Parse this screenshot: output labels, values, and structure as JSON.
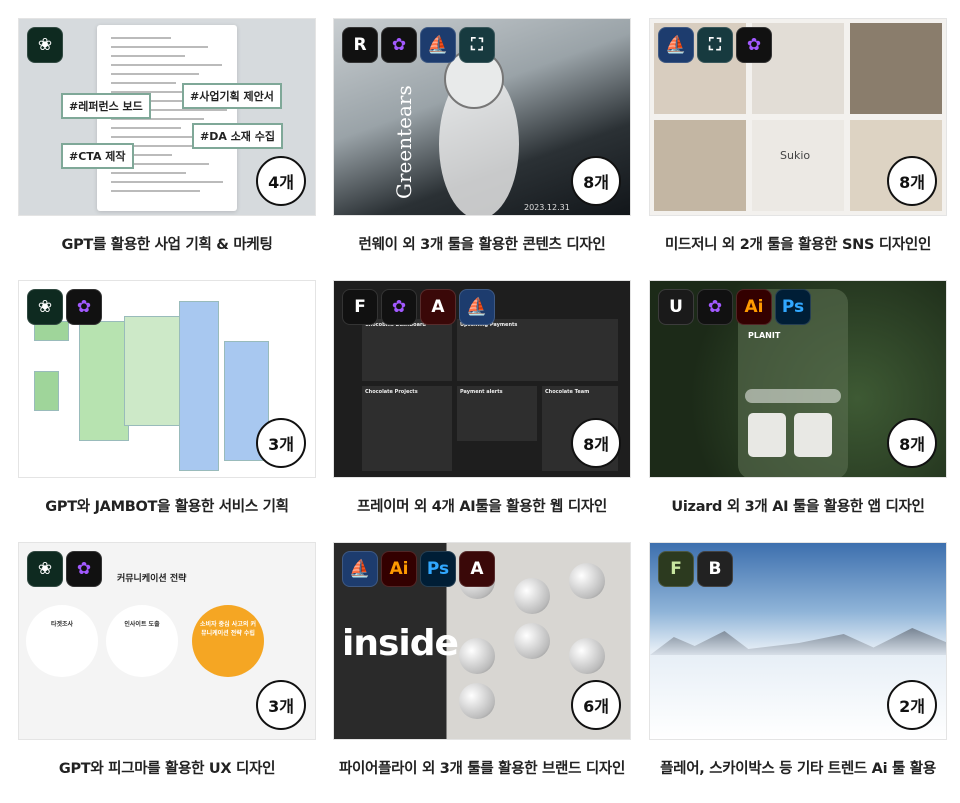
{
  "cards": [
    {
      "title": "GPT를 활용한 사업 기획 & 마케팅",
      "count": "4개",
      "icons": [
        "chatgpt-icon"
      ],
      "theme": "doc",
      "tags": [
        "#레퍼런스 보드",
        "#사업기획 제안서",
        "#DA 소재 수집",
        "#CTA 제작"
      ]
    },
    {
      "title": "런웨이 외 3개 툴을 활용한 콘텐츠 디자인",
      "count": "8개",
      "icons": [
        "runway-icon",
        "figma-icon",
        "midjourney-icon",
        "clipdrop-icon"
      ],
      "theme": "ocean",
      "text": "Greentears",
      "date": "2023.12.31"
    },
    {
      "title": "미드저니 외 2개 툴을 활용한 SNS 디자인인",
      "count": "8개",
      "icons": [
        "midjourney-icon",
        "clipdrop-icon",
        "figma-icon"
      ],
      "theme": "jewel",
      "text": "Sukio"
    },
    {
      "title": "GPT와 JAMBOT을 활용한 서비스 기획",
      "count": "3개",
      "icons": [
        "chatgpt-icon",
        "figma-icon"
      ],
      "theme": "flow"
    },
    {
      "title": "프레이머 외 4개 AI툴을 활용한 웹 디자인",
      "count": "8개",
      "icons": [
        "framer-icon",
        "figma-icon",
        "firefly-icon",
        "midjourney-icon"
      ],
      "theme": "dash",
      "panels": [
        "Chocobills Dashboard",
        "Upcoming Payments",
        "Chocolate Projects",
        "Payment alerts",
        "Chocolate Team"
      ]
    },
    {
      "title": "Uizard 외 3개 AI 툴을 활용한 앱 디자인",
      "count": "8개",
      "icons": [
        "uizard-icon",
        "figma-icon",
        "illustrator-icon",
        "photoshop-icon"
      ],
      "theme": "plant",
      "text": "PLANIT"
    },
    {
      "title": "GPT와 피그마를 활용한 UX 디자인",
      "count": "3개",
      "icons": [
        "chatgpt-icon",
        "figma-icon"
      ],
      "theme": "ux",
      "text": "커뮤니케이션 전략",
      "circles": [
        "타겟조사",
        "인사이트 도출",
        "소비자 중심 사고의 커뮤니케이션 전략 수립"
      ]
    },
    {
      "title": "파이어플라이 외 3개 툴를 활용한 브랜드 디자인",
      "count": "6개",
      "icons": [
        "midjourney-icon",
        "illustrator-icon",
        "photoshop-icon",
        "firefly-icon"
      ],
      "theme": "inside",
      "text": "inside"
    },
    {
      "title": "플레어, 스카이박스 등 기타 트렌드 Ai 툴 활용",
      "count": "2개",
      "icons": [
        "flair-icon",
        "blockade-icon"
      ],
      "theme": "snow"
    }
  ],
  "icon_styles": {
    "chatgpt-icon": {
      "bg": "#0e2a20",
      "fg": "#ffffff",
      "glyph": "❀"
    },
    "runway-icon": {
      "bg": "#111111",
      "fg": "#ffffff",
      "glyph": "R"
    },
    "figma-icon": {
      "bg": "#111111",
      "fg": "#a259ff",
      "glyph": "✿"
    },
    "midjourney-icon": {
      "bg": "#1d3c6e",
      "fg": "#ffffff",
      "glyph": "⛵"
    },
    "clipdrop-icon": {
      "bg": "#173a3f",
      "fg": "#ffffff",
      "glyph": "⛶"
    },
    "framer-icon": {
      "bg": "#111111",
      "fg": "#ffffff",
      "glyph": "F"
    },
    "firefly-icon": {
      "bg": "#3a0808",
      "fg": "#ffffff",
      "glyph": "A"
    },
    "uizard-icon": {
      "bg": "#1a1a1a",
      "fg": "#ffffff",
      "glyph": "U"
    },
    "illustrator-icon": {
      "bg": "#330000",
      "fg": "#ff9a00",
      "glyph": "Ai"
    },
    "photoshop-icon": {
      "bg": "#001e36",
      "fg": "#31a8ff",
      "glyph": "Ps"
    },
    "flair-icon": {
      "bg": "#2c3a1f",
      "fg": "#c8e6a0",
      "glyph": "F"
    },
    "blockade-icon": {
      "bg": "#222222",
      "fg": "#ffffff",
      "glyph": "B"
    }
  }
}
